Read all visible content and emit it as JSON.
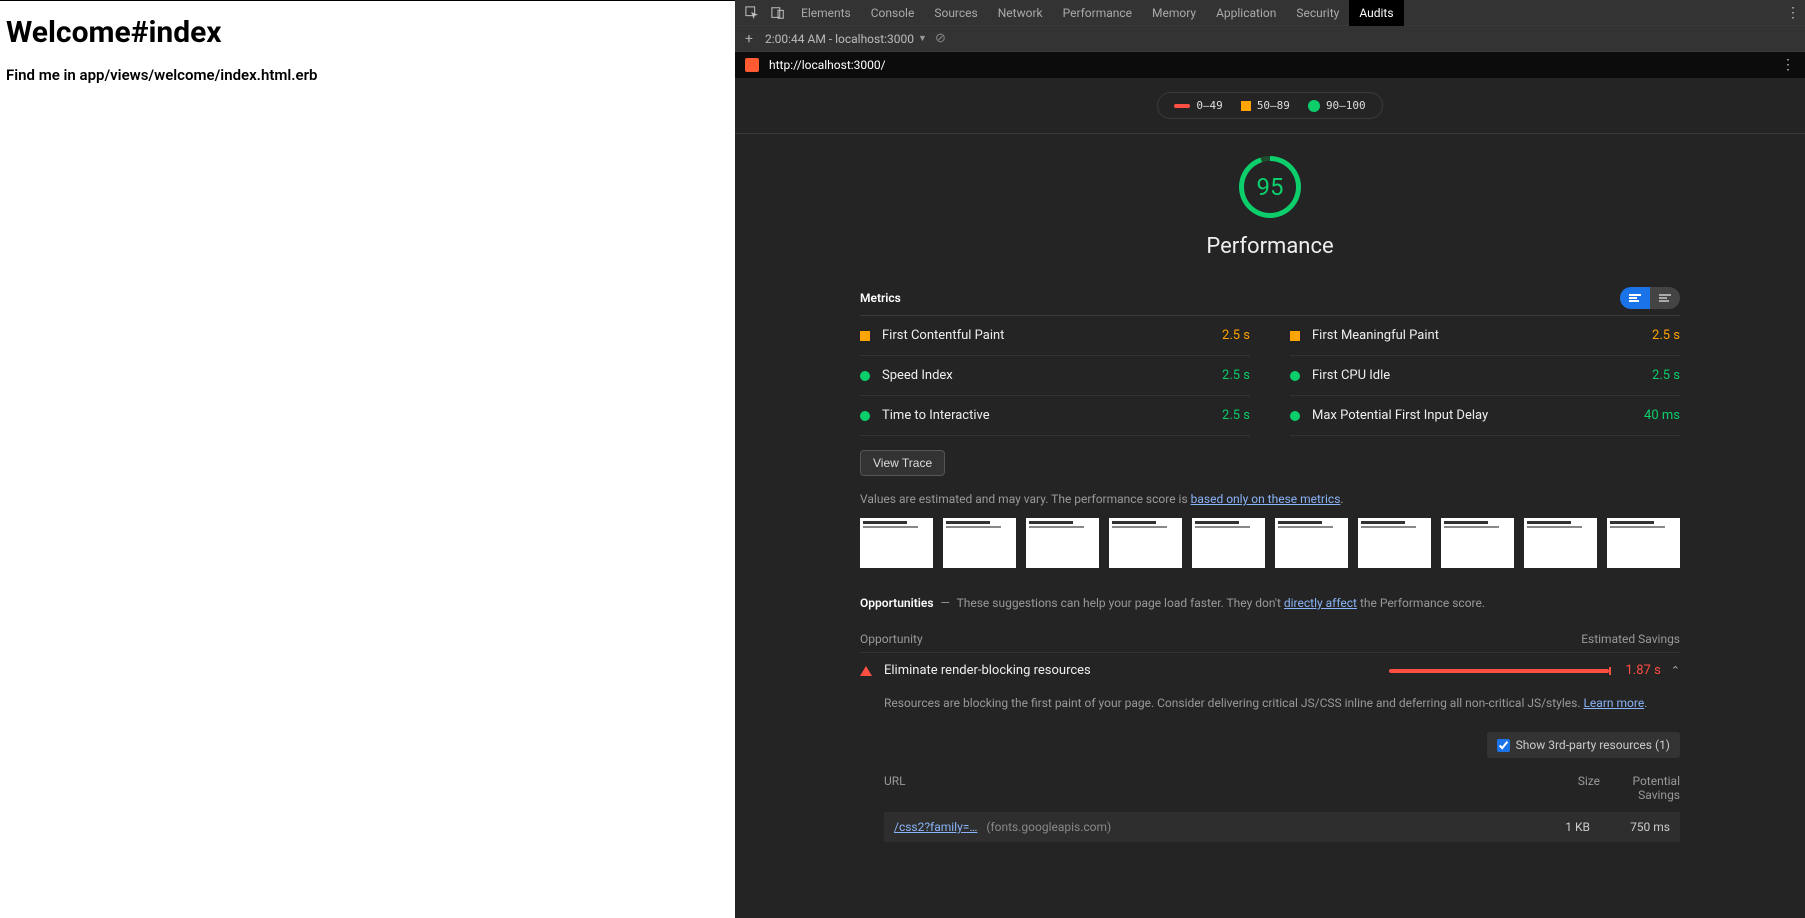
{
  "left": {
    "heading": "Welcome#index",
    "body": "Find me in app/views/welcome/index.html.erb"
  },
  "tabs": [
    "Elements",
    "Console",
    "Sources",
    "Network",
    "Performance",
    "Memory",
    "Application",
    "Security",
    "Audits"
  ],
  "active_tab": "Audits",
  "subbar": {
    "title": "2:00:44 AM - localhost:3000"
  },
  "url": "http://localhost:3000/",
  "legend": {
    "low": "0–49",
    "mid": "50–89",
    "high": "90–100"
  },
  "gauge": {
    "score": "95",
    "title": "Performance"
  },
  "sections": {
    "metrics": "Metrics",
    "opportunities": "Opportunities",
    "opp_col_left": "Opportunity",
    "opp_col_right": "Estimated Savings"
  },
  "metrics_left": [
    {
      "name": "First Contentful Paint",
      "value": "2.5 s",
      "ind": "sq-orange",
      "cls": "orange"
    },
    {
      "name": "Speed Index",
      "value": "2.5 s",
      "ind": "c-green",
      "cls": "green"
    },
    {
      "name": "Time to Interactive",
      "value": "2.5 s",
      "ind": "c-green",
      "cls": "green"
    }
  ],
  "metrics_right": [
    {
      "name": "First Meaningful Paint",
      "value": "2.5 s",
      "ind": "sq-orange",
      "cls": "orange"
    },
    {
      "name": "First CPU Idle",
      "value": "2.5 s",
      "ind": "c-green",
      "cls": "green"
    },
    {
      "name": "Max Potential First Input Delay",
      "value": "40 ms",
      "ind": "c-green",
      "cls": "green"
    }
  ],
  "view_trace": "View Trace",
  "estimate_note_pre": "Values are estimated and may vary. The performance score is ",
  "estimate_note_link": "based only on these metrics",
  "opp_desc_pre": "These suggestions can help your page load faster. They don't ",
  "opp_desc_link": "directly affect",
  "opp_desc_post": " the Performance score.",
  "opportunity": {
    "name": "Eliminate render-blocking resources",
    "value": "1.87 s",
    "detail_pre": "Resources are blocking the first paint of your page. Consider delivering critical JS/CSS inline and deferring all non-critical JS/styles. ",
    "learn_more": "Learn more"
  },
  "third_party": "Show 3rd-party resources (1)",
  "res_head": {
    "url": "URL",
    "size": "Size",
    "savings": "Potential Savings"
  },
  "resource": {
    "link": "/css2?family=…",
    "host": "(fonts.googleapis.com)",
    "size": "1 KB",
    "savings": "750 ms"
  }
}
